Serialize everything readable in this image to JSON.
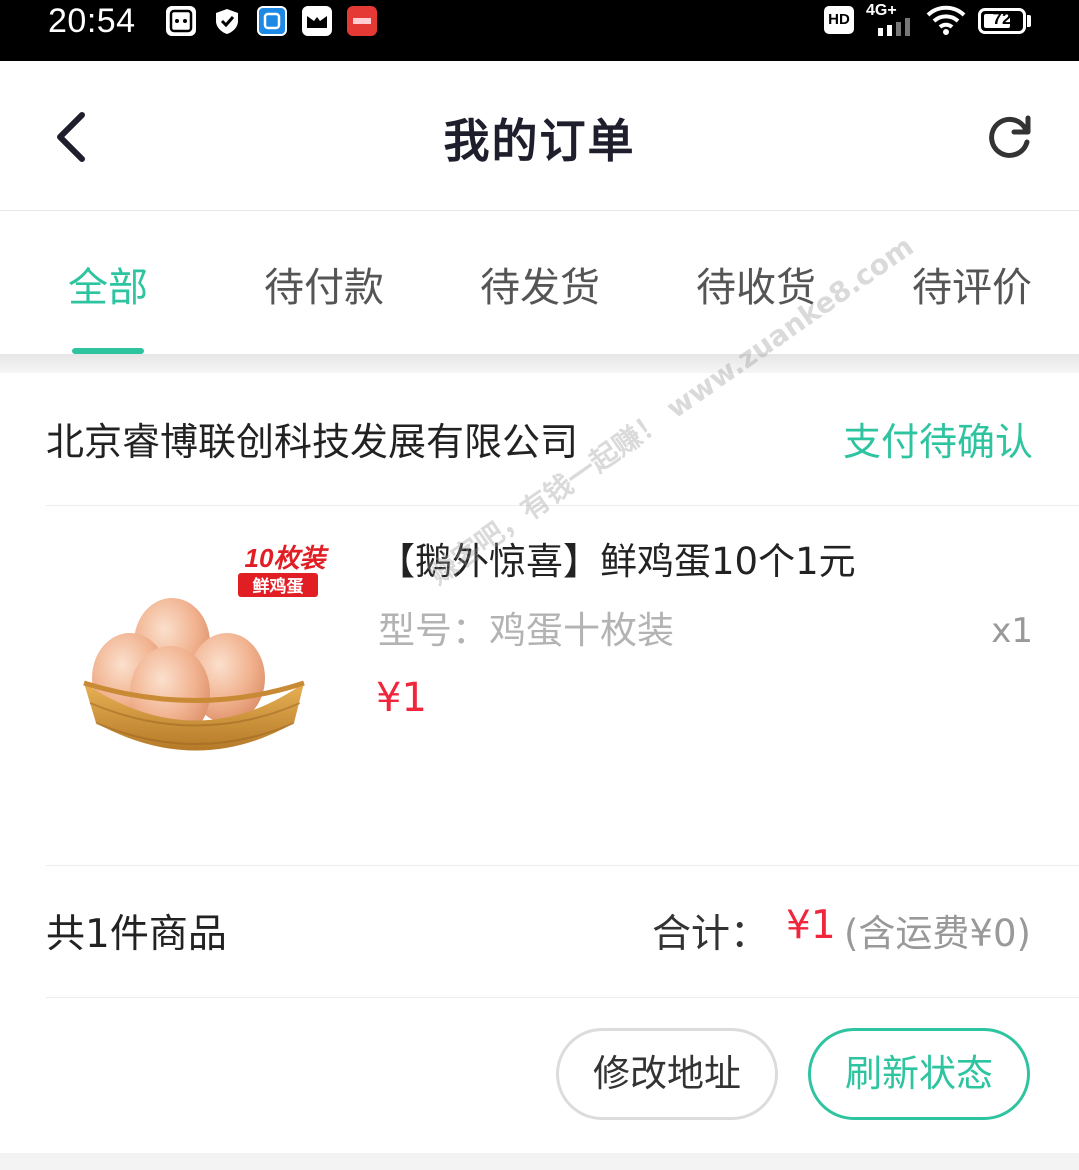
{
  "status_bar": {
    "time": "20:54",
    "network": "4G+",
    "hd": "HD",
    "battery": "72",
    "battery_level": 0.72,
    "app_icons": [
      "cat-cloud-icon",
      "shield-icon",
      "blue-app-icon",
      "book-app-icon",
      "red-app-icon"
    ]
  },
  "header": {
    "title": "我的订单",
    "back_icon": "chevron-left-icon",
    "refresh_icon": "refresh-icon"
  },
  "tabs": [
    {
      "label": "全部",
      "active": true
    },
    {
      "label": "待付款",
      "active": false
    },
    {
      "label": "待发货",
      "active": false
    },
    {
      "label": "待收货",
      "active": false
    },
    {
      "label": "待评价",
      "active": false
    }
  ],
  "order": {
    "shop_name": "北京睿博联创科技发展有限公司",
    "status": "支付待确认",
    "product": {
      "image_badge_top": "10枚装",
      "image_badge_bottom": "鲜鸡蛋",
      "title": "【鹅外惊喜】鲜鸡蛋10个1元",
      "spec": "型号：鸡蛋十枚装",
      "quantity": "x1",
      "price": "¥1"
    },
    "summary": {
      "item_count": "共1件商品",
      "total_label": "合计：",
      "total_price": "¥1",
      "shipping_note": "(含运费¥0)"
    },
    "actions": {
      "edit_address": "修改地址",
      "refresh_status": "刷新状态"
    }
  },
  "watermark": "赚客吧，有钱一起赚！ www.zuanke8.com",
  "colors": {
    "accent": "#2ec4a0",
    "price": "#f0263c",
    "title": "#1e1e2d"
  }
}
